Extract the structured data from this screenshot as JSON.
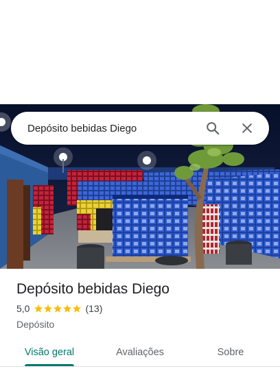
{
  "search": {
    "query": "Depósito bebidas Diego",
    "search_icon": "search-icon",
    "close_icon": "close-icon"
  },
  "place": {
    "name": "Depósito bebidas Diego",
    "rating": "5,0",
    "rating_value": 5.0,
    "stars": 5,
    "review_count": "(13)",
    "category": "Depósito"
  },
  "tabs": [
    {
      "label": "Visão geral",
      "active": true
    },
    {
      "label": "Avaliações",
      "active": false
    },
    {
      "label": "Sobre",
      "active": false
    }
  ],
  "colors": {
    "accent": "#00796b",
    "star": "#fbbc04",
    "text": "#202124",
    "secondary": "#5f6368"
  }
}
